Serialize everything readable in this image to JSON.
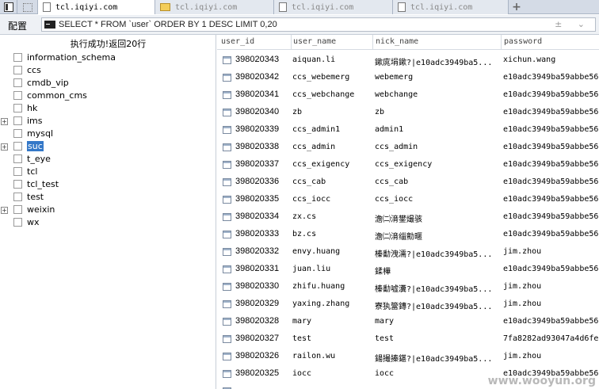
{
  "tabs": [
    {
      "label": "tcl.iqiyi.com",
      "icon": "page-icon",
      "active": true
    },
    {
      "label": "tcl.iqiyi.com",
      "icon": "folder-icon",
      "active": false
    },
    {
      "label": "tcl.iqiyi.com",
      "icon": "page-icon",
      "active": false
    },
    {
      "label": "tcl.iqiyi.com",
      "icon": "page-icon",
      "active": false
    }
  ],
  "tab_add": "+",
  "toolbar": {
    "config_label": "配置",
    "query": "SELECT * FROM `user` ORDER BY 1 DESC LIMIT 0,20",
    "query_controls": "± ⌄"
  },
  "status": "执行成功!返回20行",
  "tree": [
    {
      "name": "information_schema",
      "expandable": false,
      "selected": false
    },
    {
      "name": "ccs",
      "expandable": false,
      "selected": false
    },
    {
      "name": "cmdb_vip",
      "expandable": false,
      "selected": false
    },
    {
      "name": "common_cms",
      "expandable": false,
      "selected": false
    },
    {
      "name": "hk",
      "expandable": false,
      "selected": false
    },
    {
      "name": "ims",
      "expandable": true,
      "selected": false
    },
    {
      "name": "mysql",
      "expandable": false,
      "selected": false
    },
    {
      "name": "suc",
      "expandable": true,
      "selected": true
    },
    {
      "name": "t_eye",
      "expandable": false,
      "selected": false
    },
    {
      "name": "tcl",
      "expandable": false,
      "selected": false
    },
    {
      "name": "tcl_test",
      "expandable": false,
      "selected": false
    },
    {
      "name": "test",
      "expandable": false,
      "selected": false
    },
    {
      "name": "weixin",
      "expandable": true,
      "selected": false
    },
    {
      "name": "wx",
      "expandable": false,
      "selected": false
    }
  ],
  "grid": {
    "columns": [
      "user_id",
      "user_name",
      "nick_name",
      "password"
    ],
    "rows": [
      {
        "user_id": "398020343",
        "user_name": "aiquan.li",
        "nick_name": "鏉庣埍鏉?|e10adc3949ba5...",
        "password": "xichun.wang"
      },
      {
        "user_id": "398020342",
        "user_name": "ccs_webemerg",
        "nick_name": "webemerg",
        "password": "e10adc3949ba59abbe56"
      },
      {
        "user_id": "398020341",
        "user_name": "ccs_webchange",
        "nick_name": "webchange",
        "password": "e10adc3949ba59abbe56"
      },
      {
        "user_id": "398020340",
        "user_name": "zb",
        "nick_name": "zb",
        "password": "e10adc3949ba59abbe56"
      },
      {
        "user_id": "398020339",
        "user_name": "ccs_admin1",
        "nick_name": "admin1",
        "password": "e10adc3949ba59abbe56"
      },
      {
        "user_id": "398020338",
        "user_name": "ccs_admin",
        "nick_name": "ccs_admin",
        "password": "e10adc3949ba59abbe56"
      },
      {
        "user_id": "398020337",
        "user_name": "ccs_exigency",
        "nick_name": "ccs_exigency",
        "password": "e10adc3949ba59abbe56"
      },
      {
        "user_id": "398020336",
        "user_name": "ccs_cab",
        "nick_name": "ccs_cab",
        "password": "e10adc3949ba59abbe56"
      },
      {
        "user_id": "398020335",
        "user_name": "ccs_iocc",
        "nick_name": "ccs_iocc",
        "password": "e10adc3949ba59abbe56"
      },
      {
        "user_id": "398020334",
        "user_name": "zx.cs",
        "nick_name": "澹㈡湇鐢熶骇",
        "password": "e10adc3949ba59abbe56"
      },
      {
        "user_id": "398020333",
        "user_name": "bz.cs",
        "nick_name": "澹㈡湇缁勯暱",
        "password": "e10adc3949ba59abbe56"
      },
      {
        "user_id": "398020332",
        "user_name": "envy.huang",
        "nick_name": "榛勫洩濡?|e10adc3949ba5...",
        "password": "jim.zhou"
      },
      {
        "user_id": "398020331",
        "user_name": "juan.liu",
        "nick_name": "鍒樺",
        "password": "e10adc3949ba59abbe56"
      },
      {
        "user_id": "398020330",
        "user_name": "zhifu.huang",
        "nick_name": "榛勫嘘瀵?|e10adc3949ba5...",
        "password": "jim.zhou"
      },
      {
        "user_id": "398020329",
        "user_name": "yaxing.zhang",
        "nick_name": "寮犱簹鏄?|e10adc3949ba5...",
        "password": "jim.zhou"
      },
      {
        "user_id": "398020328",
        "user_name": "mary",
        "nick_name": "mary",
        "password": "e10adc3949ba59abbe56"
      },
      {
        "user_id": "398020327",
        "user_name": "test",
        "nick_name": "test",
        "password": "7fa8282ad93047a4d6fe"
      },
      {
        "user_id": "398020326",
        "user_name": "railon.wu",
        "nick_name": "鍚撮搸鍖?|e10adc3949ba5...",
        "password": "jim.zhou"
      },
      {
        "user_id": "398020325",
        "user_name": "iocc",
        "nick_name": "iocc",
        "password": "e10adc3949ba59abbe56"
      },
      {
        "user_id": "",
        "user_name": "",
        "nick_name": "",
        "password": ""
      }
    ]
  },
  "watermark": "www.wooyun.org",
  "colors": {
    "selection": "#3478c8",
    "tab_bar": "#d4dbe6",
    "folder": "#f3cd5a"
  }
}
